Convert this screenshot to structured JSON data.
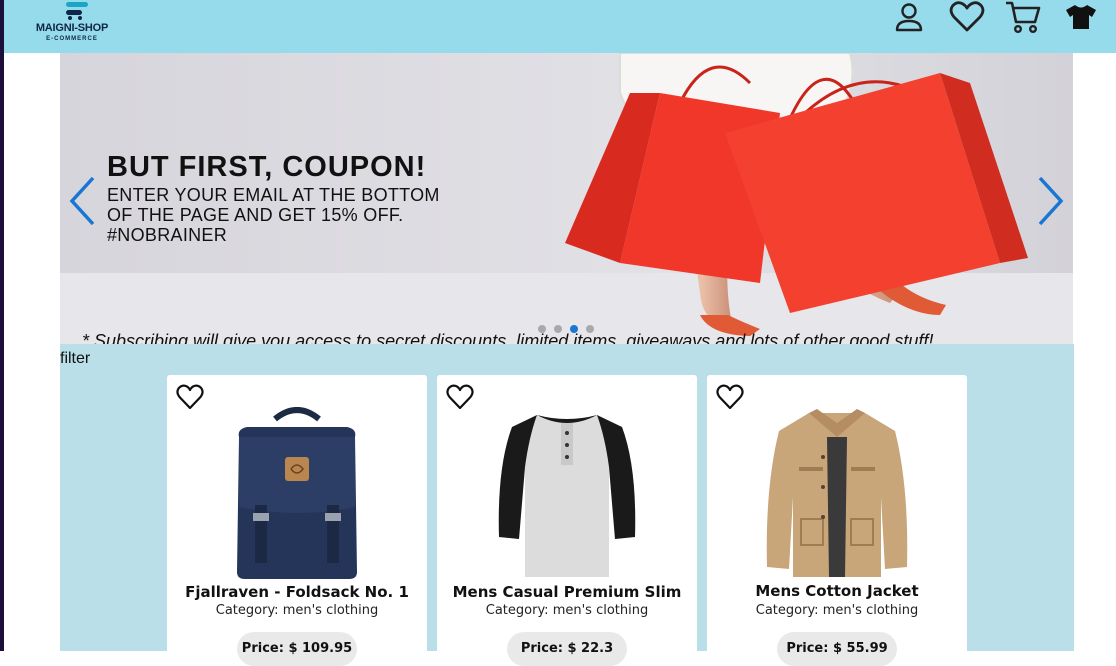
{
  "brand": {
    "name": "MAIGNI-SHOP",
    "tagline": "E-COMMERCE"
  },
  "nav": {
    "icons": [
      "user-icon",
      "heart-icon",
      "cart-icon",
      "tshirt-icon"
    ]
  },
  "banner": {
    "title": "BUT FIRST, COUPON!",
    "lines": [
      "ENTER YOUR EMAIL  AT THE BOTTOM",
      "OF THE PAGE AND GET 15% OFF.",
      "#NOBRAINER"
    ],
    "footnote": "* Subscribing will give you access to secret discounts, limited items, giveaways and lots of other good stuff!",
    "slide_count": 4,
    "active_slide": 3
  },
  "catalog": {
    "filter_label": "filter",
    "products": [
      {
        "title": "Fjallraven - Foldsack No. 1",
        "category": "Category: men's clothing",
        "price": "Price: $ 109.95",
        "image": "backpack"
      },
      {
        "title": "Mens Casual Premium Slim",
        "category": "Category: men's clothing",
        "price": "Price: $ 22.3",
        "image": "henley-tshirt"
      },
      {
        "title": "Mens Cotton Jacket",
        "category": "Category: men's clothing",
        "price": "Price: $ 55.99",
        "image": "cotton-jacket"
      }
    ]
  },
  "colors": {
    "navbar": "#96dbec",
    "catalog": "#badfe9",
    "accent": "#1976d2"
  }
}
